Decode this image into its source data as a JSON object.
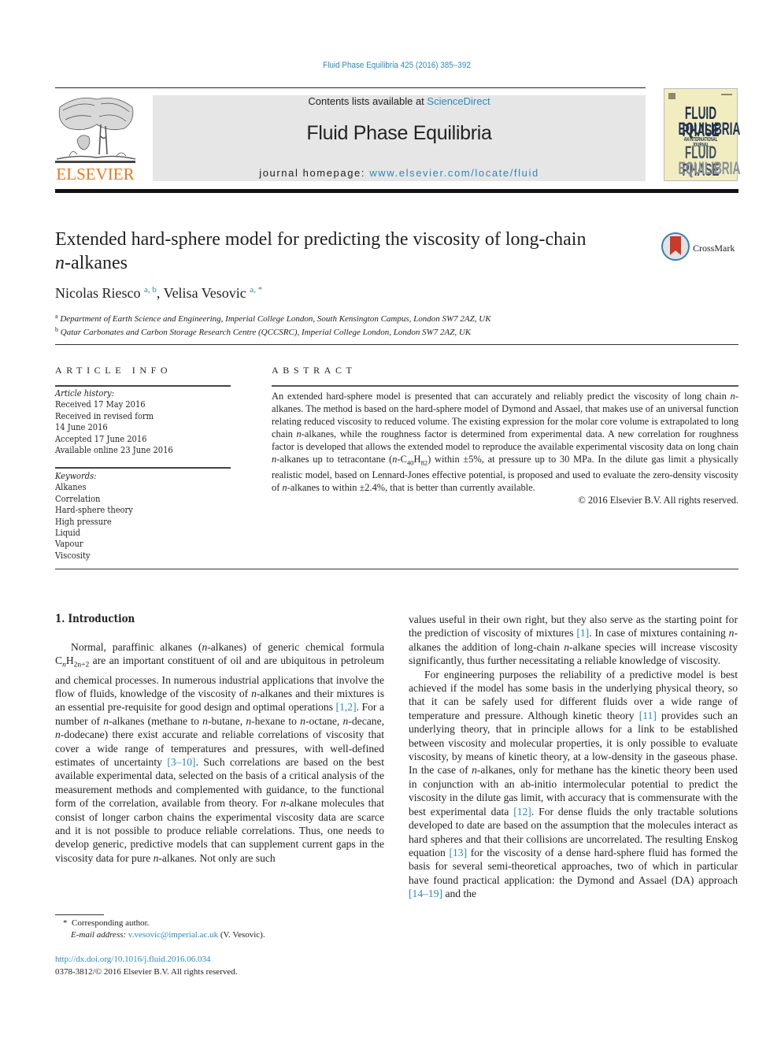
{
  "header": {
    "journal_ref": "Fluid Phase Equilibria 425 (2016) 385–392",
    "contents_prefix": "Contents lists available at ",
    "contents_link": "ScienceDirect",
    "journal_title": "Fluid Phase Equilibria",
    "homepage_prefix": "journal homepage: ",
    "homepage_link": "www.elsevier.com/locate/fluid",
    "publisher_logo_text": "ELSEVIER",
    "cover_lines": [
      "FLUID PHASE",
      "EQUILIBRIA",
      "AN INTERNATIONAL JOURNAL",
      "FLUID PHASE",
      "EQUILIBRIA"
    ],
    "colors": {
      "link": "#2a8ab8",
      "elsevier_orange": "#e87722",
      "masthead_bg": "#e6e6e6",
      "cover_bg": "#f1edc0",
      "cover_ink": "#1f3050"
    }
  },
  "article": {
    "title_line1": "Extended hard-sphere model for predicting the viscosity of long-chain",
    "title_line2_italic": "n",
    "title_line2_rest": "-alkanes",
    "crossmark_label": "CrossMark",
    "authors": [
      {
        "name": "Nicolas Riesco",
        "marks": "a, b"
      },
      {
        "name": "Velisa Vesovic",
        "marks": "a, *"
      }
    ],
    "author_separator": ", ",
    "affiliations": [
      {
        "mark": "a",
        "text": "Department of Earth Science and Engineering, Imperial College London, South Kensington Campus, London SW7 2AZ, UK"
      },
      {
        "mark": "b",
        "text": "Qatar Carbonates and Carbon Storage Research Centre (QCCSRC), Imperial College London, London SW7 2AZ, UK"
      }
    ]
  },
  "article_info": {
    "heading": "ARTICLE INFO",
    "history_label": "Article history:",
    "history": [
      "Received 17 May 2016",
      "Received in revised form",
      "14 June 2016",
      "Accepted 17 June 2016",
      "Available online 23 June 2016"
    ],
    "keywords_label": "Keywords:",
    "keywords": [
      "Alkanes",
      "Correlation",
      "Hard-sphere theory",
      "High pressure",
      "Liquid",
      "Vapour",
      "Viscosity"
    ]
  },
  "abstract": {
    "heading": "ABSTRACT",
    "p1": "An extended hard-sphere model is presented that can accurately and reliably predict the viscosity of long chain ",
    "p2": "-alkanes. The method is based on the hard-sphere model of Dymond and Assael, that makes use of an universal function relating reduced viscosity to reduced volume. The existing expression for the molar core volume is extrapolated to long chain ",
    "p3": "-alkanes, while the roughness factor is determined from experimental data. A new correlation for roughness factor is developed that allows the extended model to reproduce the available experimental viscosity data on long chain ",
    "p4": "-alkanes up to tetracontane (",
    "p5": "-C",
    "sub1": "40",
    "p6": "H",
    "sub2": "82",
    "p7": ") within ±5%, at pressure up to 30 MPa. In the dilute gas limit a physically realistic model, based on Lennard-Jones effective potential, is proposed and used to evaluate the zero-density viscosity of ",
    "p8": "-alkanes to within ±2.4%, that is better than currently available.",
    "n": "n",
    "copyright": "© 2016 Elsevier B.V. All rights reserved."
  },
  "body": {
    "section_heading": "1.  Introduction",
    "n": "n",
    "left": {
      "a1": "Normal, paraffinic alkanes (",
      "a2": "-alkanes) of generic chemical formula C",
      "sub_n": "n",
      "a3": "H",
      "sub_2n2": "2n+2",
      "a4": " are an important constituent of oil and are ubiquitous in petroleum and chemical processes. In numerous industrial applications that involve the flow of fluids, knowledge of the viscosity of ",
      "a5": "-alkanes and their mixtures is an essential pre-requisite for good design and optimal operations ",
      "ref1": "[1,2]",
      "a6": ". For a number of ",
      "a7": "-alkanes (methane to ",
      "a8": "-butane, ",
      "a9": "-hexane to ",
      "a10": "-octane, ",
      "a11": "-decane, ",
      "a12": "-dodecane) there exist accurate and reliable correlations of viscosity that cover a wide range of temperatures and pressures, with well-defined estimates of uncertainty ",
      "ref2": "[3–10]",
      "a13": ". Such correlations are based on the best available experimental data, selected on the basis of a critical analysis of the measurement methods and complemented with guidance, to the functional form of the correlation, available from theory. For ",
      "a14": "-alkane molecules that consist of longer carbon chains the experimental viscosity data are scarce and it is not possible to produce reliable correlations. Thus, one needs to develop generic, predictive models that can supplement current gaps in the viscosity data for pure ",
      "a15": "-alkanes. Not only are such"
    },
    "right": {
      "b1": "values useful in their own right, but they also serve as the starting point for the prediction of viscosity of mixtures ",
      "ref1": "[1]",
      "b2": ". In case of mixtures containing ",
      "b3": "-alkanes the addition of long-chain ",
      "b4": "-alkane species will increase viscosity significantly, thus further necessitating a reliable knowledge of viscosity.",
      "c1": "For engineering purposes the reliability of a predictive model is best achieved if the model has some basis in the underlying physical theory, so that it can be safely used for different fluids over a wide range of temperature and pressure. Although kinetic theory ",
      "ref2": "[11]",
      "c2": " provides such an underlying theory, that in principle allows for a link to be established between viscosity and molecular properties, it is only possible to evaluate viscosity, by means of kinetic theory, at a low-density in the gaseous phase. In the case of ",
      "c3": "-alkanes, only for methane has the kinetic theory been used in conjunction with an ab-initio intermolecular potential to predict the viscosity in the dilute gas limit, with accuracy that is commensurate with the best experimental data ",
      "ref3": "[12]",
      "c4": ". For dense fluids the only tractable solutions developed to date are based on the assumption that the molecules interact as hard spheres and that their collisions are uncorrelated. The resulting Enskog equation ",
      "ref4": "[13]",
      "c5": " for the viscosity of a dense hard-sphere fluid has formed the basis for several semi-theoretical approaches, two of which in particular have found practical application: the Dymond and Assael (DA) approach ",
      "ref5": "[14–19]",
      "c6": " and the"
    }
  },
  "footer": {
    "star": "*",
    "corresponding": "Corresponding author.",
    "email_label": "E-mail address: ",
    "email": "v.vesovic@imperial.ac.uk",
    "email_suffix": " (V. Vesovic).",
    "doi": "http://dx.doi.org/10.1016/j.fluid.2016.06.034",
    "issn": "0378-3812/© 2016 Elsevier B.V. All rights reserved."
  }
}
